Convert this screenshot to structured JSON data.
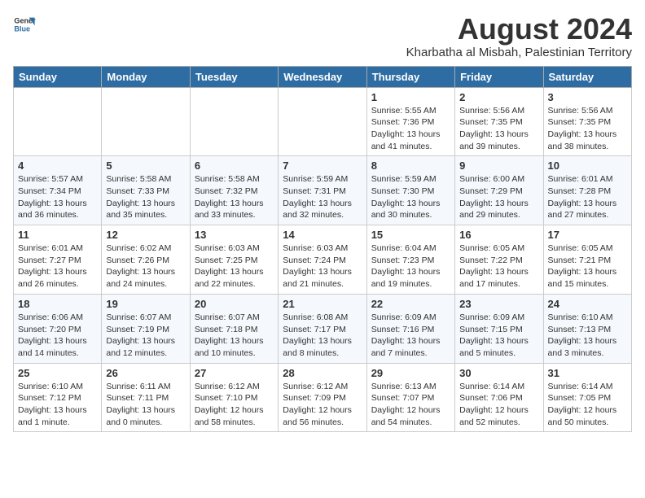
{
  "logo": {
    "line1": "General",
    "line2": "Blue"
  },
  "title": "August 2024",
  "location": "Kharbatha al Misbah, Palestinian Territory",
  "weekdays": [
    "Sunday",
    "Monday",
    "Tuesday",
    "Wednesday",
    "Thursday",
    "Friday",
    "Saturday"
  ],
  "weeks": [
    [
      {
        "day": "",
        "info": ""
      },
      {
        "day": "",
        "info": ""
      },
      {
        "day": "",
        "info": ""
      },
      {
        "day": "",
        "info": ""
      },
      {
        "day": "1",
        "info": "Sunrise: 5:55 AM\nSunset: 7:36 PM\nDaylight: 13 hours\nand 41 minutes."
      },
      {
        "day": "2",
        "info": "Sunrise: 5:56 AM\nSunset: 7:35 PM\nDaylight: 13 hours\nand 39 minutes."
      },
      {
        "day": "3",
        "info": "Sunrise: 5:56 AM\nSunset: 7:35 PM\nDaylight: 13 hours\nand 38 minutes."
      }
    ],
    [
      {
        "day": "4",
        "info": "Sunrise: 5:57 AM\nSunset: 7:34 PM\nDaylight: 13 hours\nand 36 minutes."
      },
      {
        "day": "5",
        "info": "Sunrise: 5:58 AM\nSunset: 7:33 PM\nDaylight: 13 hours\nand 35 minutes."
      },
      {
        "day": "6",
        "info": "Sunrise: 5:58 AM\nSunset: 7:32 PM\nDaylight: 13 hours\nand 33 minutes."
      },
      {
        "day": "7",
        "info": "Sunrise: 5:59 AM\nSunset: 7:31 PM\nDaylight: 13 hours\nand 32 minutes."
      },
      {
        "day": "8",
        "info": "Sunrise: 5:59 AM\nSunset: 7:30 PM\nDaylight: 13 hours\nand 30 minutes."
      },
      {
        "day": "9",
        "info": "Sunrise: 6:00 AM\nSunset: 7:29 PM\nDaylight: 13 hours\nand 29 minutes."
      },
      {
        "day": "10",
        "info": "Sunrise: 6:01 AM\nSunset: 7:28 PM\nDaylight: 13 hours\nand 27 minutes."
      }
    ],
    [
      {
        "day": "11",
        "info": "Sunrise: 6:01 AM\nSunset: 7:27 PM\nDaylight: 13 hours\nand 26 minutes."
      },
      {
        "day": "12",
        "info": "Sunrise: 6:02 AM\nSunset: 7:26 PM\nDaylight: 13 hours\nand 24 minutes."
      },
      {
        "day": "13",
        "info": "Sunrise: 6:03 AM\nSunset: 7:25 PM\nDaylight: 13 hours\nand 22 minutes."
      },
      {
        "day": "14",
        "info": "Sunrise: 6:03 AM\nSunset: 7:24 PM\nDaylight: 13 hours\nand 21 minutes."
      },
      {
        "day": "15",
        "info": "Sunrise: 6:04 AM\nSunset: 7:23 PM\nDaylight: 13 hours\nand 19 minutes."
      },
      {
        "day": "16",
        "info": "Sunrise: 6:05 AM\nSunset: 7:22 PM\nDaylight: 13 hours\nand 17 minutes."
      },
      {
        "day": "17",
        "info": "Sunrise: 6:05 AM\nSunset: 7:21 PM\nDaylight: 13 hours\nand 15 minutes."
      }
    ],
    [
      {
        "day": "18",
        "info": "Sunrise: 6:06 AM\nSunset: 7:20 PM\nDaylight: 13 hours\nand 14 minutes."
      },
      {
        "day": "19",
        "info": "Sunrise: 6:07 AM\nSunset: 7:19 PM\nDaylight: 13 hours\nand 12 minutes."
      },
      {
        "day": "20",
        "info": "Sunrise: 6:07 AM\nSunset: 7:18 PM\nDaylight: 13 hours\nand 10 minutes."
      },
      {
        "day": "21",
        "info": "Sunrise: 6:08 AM\nSunset: 7:17 PM\nDaylight: 13 hours\nand 8 minutes."
      },
      {
        "day": "22",
        "info": "Sunrise: 6:09 AM\nSunset: 7:16 PM\nDaylight: 13 hours\nand 7 minutes."
      },
      {
        "day": "23",
        "info": "Sunrise: 6:09 AM\nSunset: 7:15 PM\nDaylight: 13 hours\nand 5 minutes."
      },
      {
        "day": "24",
        "info": "Sunrise: 6:10 AM\nSunset: 7:13 PM\nDaylight: 13 hours\nand 3 minutes."
      }
    ],
    [
      {
        "day": "25",
        "info": "Sunrise: 6:10 AM\nSunset: 7:12 PM\nDaylight: 13 hours\nand 1 minute."
      },
      {
        "day": "26",
        "info": "Sunrise: 6:11 AM\nSunset: 7:11 PM\nDaylight: 13 hours\nand 0 minutes."
      },
      {
        "day": "27",
        "info": "Sunrise: 6:12 AM\nSunset: 7:10 PM\nDaylight: 12 hours\nand 58 minutes."
      },
      {
        "day": "28",
        "info": "Sunrise: 6:12 AM\nSunset: 7:09 PM\nDaylight: 12 hours\nand 56 minutes."
      },
      {
        "day": "29",
        "info": "Sunrise: 6:13 AM\nSunset: 7:07 PM\nDaylight: 12 hours\nand 54 minutes."
      },
      {
        "day": "30",
        "info": "Sunrise: 6:14 AM\nSunset: 7:06 PM\nDaylight: 12 hours\nand 52 minutes."
      },
      {
        "day": "31",
        "info": "Sunrise: 6:14 AM\nSunset: 7:05 PM\nDaylight: 12 hours\nand 50 minutes."
      }
    ]
  ]
}
